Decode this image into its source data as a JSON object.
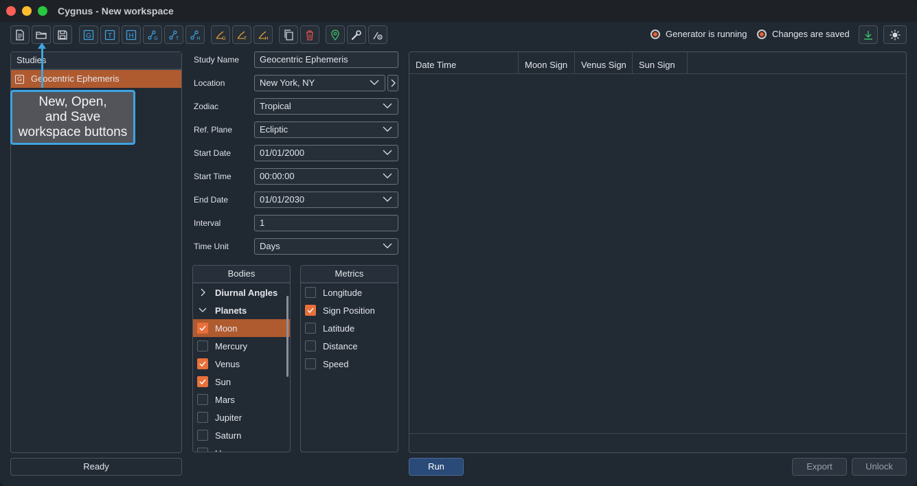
{
  "window": {
    "title": "Cygnus - New workspace"
  },
  "toolbar": {
    "icons": [
      "new-file-icon",
      "open-folder-icon",
      "save-icon",
      "geocentric-study-icon",
      "topocentric-study-icon",
      "heliocentric-study-icon",
      "geo-chart-icon",
      "topo-chart-icon",
      "helio-chart-icon",
      "geo-angle-icon",
      "topo-angle-icon",
      "helio-angle-icon",
      "copy-icon",
      "trash-icon",
      "location-pin-icon",
      "wrench-icon",
      "settings-gear-icon"
    ],
    "letters": {
      "g": "G",
      "t": "T",
      "h": "H"
    }
  },
  "status": {
    "generator": "Generator is running",
    "saved": "Changes are saved",
    "colors": {
      "indicator": "#e8623a",
      "accent": "#b05a30",
      "run": "#2a4a78",
      "callout_border": "#3fa4e0"
    }
  },
  "studies": {
    "header": "Studies",
    "items": [
      {
        "badge": "G",
        "label": "Geocentric Ephemeris"
      }
    ]
  },
  "callout": {
    "line1": "New, Open,",
    "line2": "and Save",
    "line3": "workspace buttons"
  },
  "ready": "Ready",
  "form": {
    "study_name": {
      "label": "Study Name",
      "value": "Geocentric Ephemeris"
    },
    "location": {
      "label": "Location",
      "value": "New York, NY"
    },
    "zodiac": {
      "label": "Zodiac",
      "value": "Tropical"
    },
    "ref_plane": {
      "label": "Ref. Plane",
      "value": "Ecliptic"
    },
    "start_date": {
      "label": "Start Date",
      "value": "01/01/2000"
    },
    "start_time": {
      "label": "Start Time",
      "value": "00:00:00"
    },
    "end_date": {
      "label": "End Date",
      "value": "01/01/2030"
    },
    "interval": {
      "label": "Interval",
      "value": "1"
    },
    "time_unit": {
      "label": "Time Unit",
      "value": "Days"
    }
  },
  "bodies": {
    "header": "Bodies",
    "groups": [
      {
        "label": "Diurnal Angles",
        "expanded": false
      },
      {
        "label": "Planets",
        "expanded": true
      }
    ],
    "items": [
      {
        "label": "Moon",
        "checked": true,
        "selected": true
      },
      {
        "label": "Mercury",
        "checked": false
      },
      {
        "label": "Venus",
        "checked": true
      },
      {
        "label": "Sun",
        "checked": true
      },
      {
        "label": "Mars",
        "checked": false
      },
      {
        "label": "Jupiter",
        "checked": false
      },
      {
        "label": "Saturn",
        "checked": false
      },
      {
        "label": "U",
        "checked": false
      }
    ]
  },
  "metrics": {
    "header": "Metrics",
    "items": [
      {
        "label": "Longitude",
        "checked": false
      },
      {
        "label": "Sign Position",
        "checked": true
      },
      {
        "label": "Latitude",
        "checked": false
      },
      {
        "label": "Distance",
        "checked": false
      },
      {
        "label": "Speed",
        "checked": false
      }
    ]
  },
  "results": {
    "columns": [
      "Date Time",
      "Moon Sign",
      "Venus Sign",
      "Sun Sign"
    ]
  },
  "buttons": {
    "run": "Run",
    "export": "Export",
    "unlock": "Unlock"
  }
}
